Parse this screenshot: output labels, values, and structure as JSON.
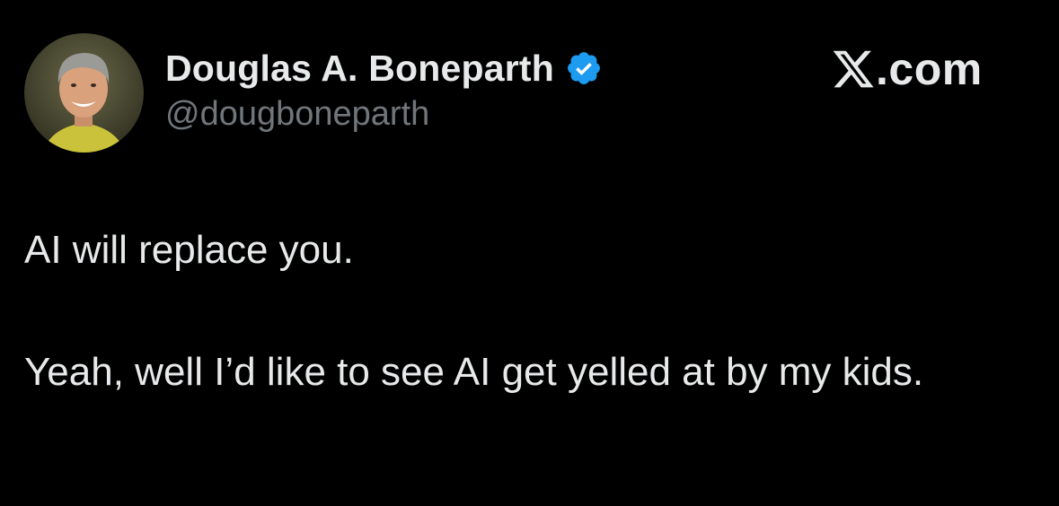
{
  "author": {
    "display_name": "Douglas A. Boneparth",
    "handle": "@dougboneparth",
    "verified": true,
    "avatar_icon": "profile-photo"
  },
  "brand": {
    "logo_icon": "x-logo-icon",
    "suffix": ".com"
  },
  "tweet": {
    "paragraphs": [
      "AI will replace you.",
      "Yeah, well I’d like to see AI get yelled at by my kids."
    ]
  },
  "colors": {
    "background": "#000000",
    "text_primary": "#e7e9ea",
    "text_secondary": "#71767b",
    "verified_blue": "#1d9bf0"
  }
}
